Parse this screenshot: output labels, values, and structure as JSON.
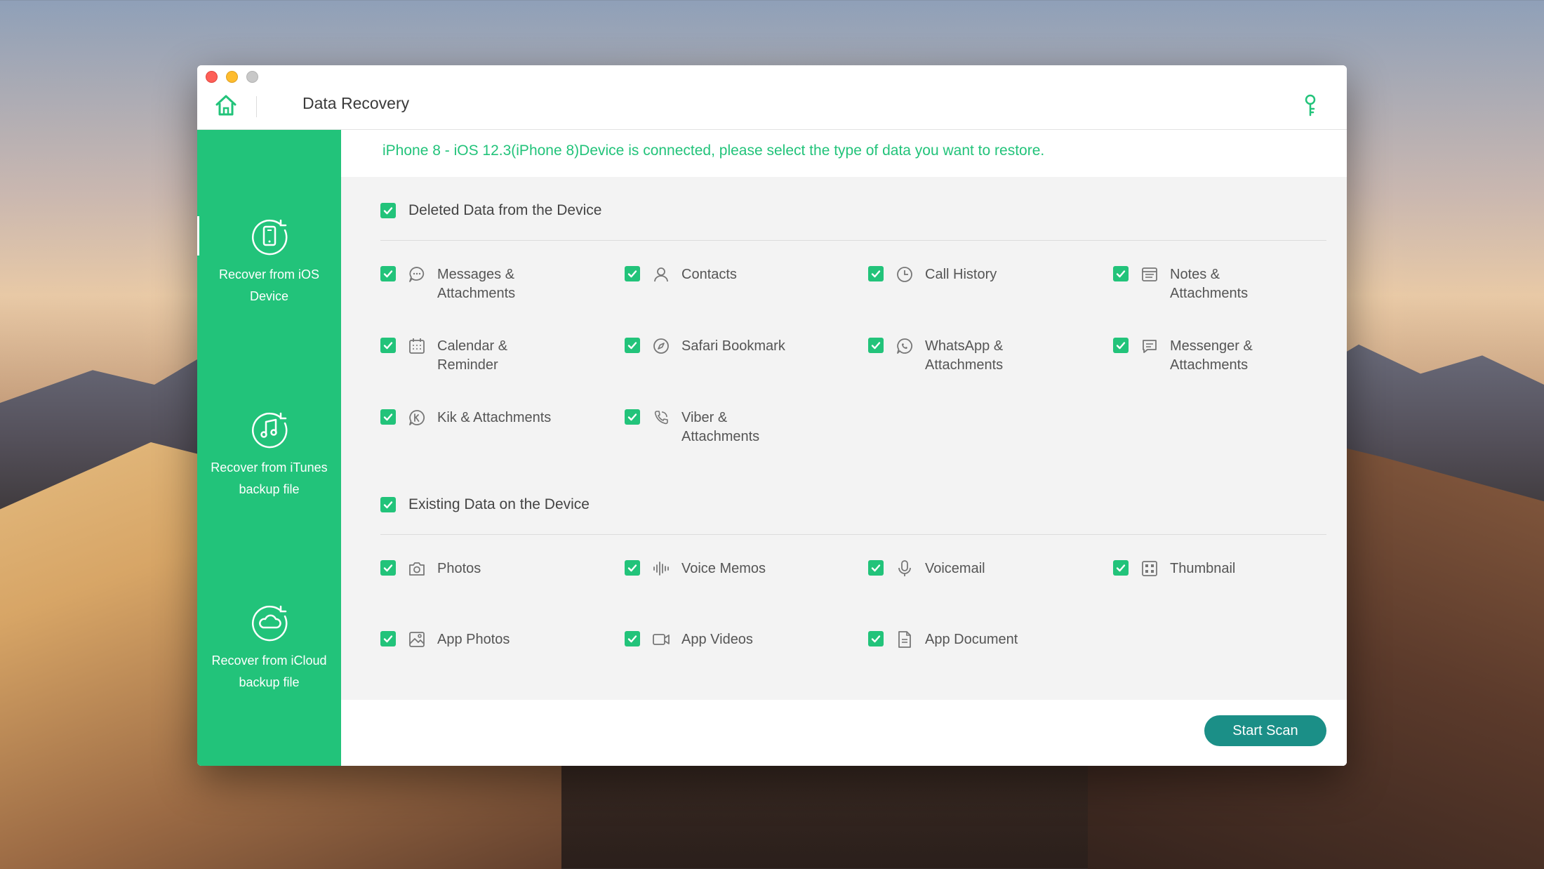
{
  "window": {
    "title": "Data Recovery"
  },
  "sidebar": {
    "items": [
      {
        "label": "Recover from iOS Device",
        "icon": "phone-recover-icon",
        "active": true
      },
      {
        "label": "Recover from iTunes backup file",
        "icon": "itunes-icon",
        "active": false
      },
      {
        "label": "Recover from iCloud backup file",
        "icon": "icloud-icon",
        "active": false
      }
    ]
  },
  "status": {
    "message": "iPhone 8 - iOS 12.3(iPhone 8)Device is connected, please select the type of data you want to restore."
  },
  "sections": {
    "deleted": {
      "title": "Deleted Data from the Device",
      "items": [
        {
          "label": "Messages & Attachments",
          "icon": "message-icon"
        },
        {
          "label": "Contacts",
          "icon": "contact-icon"
        },
        {
          "label": "Call History",
          "icon": "clock-icon"
        },
        {
          "label": "Notes & Attachments",
          "icon": "notes-icon"
        },
        {
          "label": "Calendar & Reminder",
          "icon": "calendar-icon"
        },
        {
          "label": "Safari Bookmark",
          "icon": "compass-icon"
        },
        {
          "label": "WhatsApp & Attachments",
          "icon": "whatsapp-icon"
        },
        {
          "label": "Messenger & Attachments",
          "icon": "messenger-icon"
        },
        {
          "label": "Kik & Attachments",
          "icon": "kik-icon"
        },
        {
          "label": "Viber & Attachments",
          "icon": "viber-icon"
        }
      ]
    },
    "existing": {
      "title": "Existing Data on the Device",
      "items": [
        {
          "label": "Photos",
          "icon": "camera-icon"
        },
        {
          "label": "Voice Memos",
          "icon": "waveform-icon"
        },
        {
          "label": "Voicemail",
          "icon": "microphone-icon"
        },
        {
          "label": "Thumbnail",
          "icon": "grid-icon"
        },
        {
          "label": "App Photos",
          "icon": "image-icon"
        },
        {
          "label": "App Videos",
          "icon": "video-icon"
        },
        {
          "label": "App Document",
          "icon": "document-icon"
        }
      ]
    }
  },
  "footer": {
    "start_label": "Start Scan"
  },
  "colors": {
    "accent": "#22c37a",
    "button": "#1b8f87"
  }
}
